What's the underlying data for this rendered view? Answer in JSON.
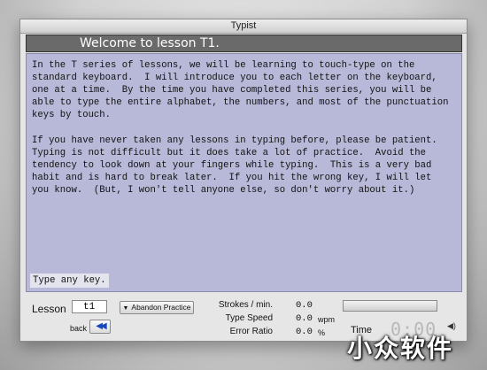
{
  "window": {
    "title": "Typist"
  },
  "lesson": {
    "header": "Welcome to lesson T1.",
    "body": "In the T series of lessons, we will be learning to touch-type on the\nstandard keyboard.  I will introduce you to each letter on the keyboard,\none at a time.  By the time you have completed this series, you will be\nable to type the entire alphabet, the numbers, and most of the punctuation\nkeys by touch.\n\nIf you have never taken any lessons in typing before, please be patient.\nTyping is not difficult but it does take a lot of practice.  Avoid the\ntendency to look down at your fingers while typing.  This is a very bad\nhabit and is hard to break later.  If you hit the wrong key, I will let\nyou know.  (But, I won't tell anyone else, so don't worry about it.)",
    "prompt": "Type any key."
  },
  "controls": {
    "lesson_label": "Lesson",
    "lesson_value": "t1",
    "abandon_label": "Abandon Practice",
    "back_label": "back",
    "strokes_label": "Strokes / min.",
    "strokes_value": "0.0",
    "speed_label": "Type Speed",
    "speed_value": "0.0",
    "speed_unit": "wpm",
    "error_label": "Error Ratio",
    "error_value": "0.0",
    "error_unit": "%",
    "time_label": "Time",
    "time_value": "0:00",
    "progress": 0
  },
  "icons": {
    "abandon": "triangle-down-icon",
    "back": "rewind-icon",
    "sound": "speaker-icon"
  },
  "colors": {
    "content_bg": "#b8b9d8",
    "header_bg": "#6a6a6a",
    "accent": "#1548c0"
  },
  "watermark": "小众软件"
}
